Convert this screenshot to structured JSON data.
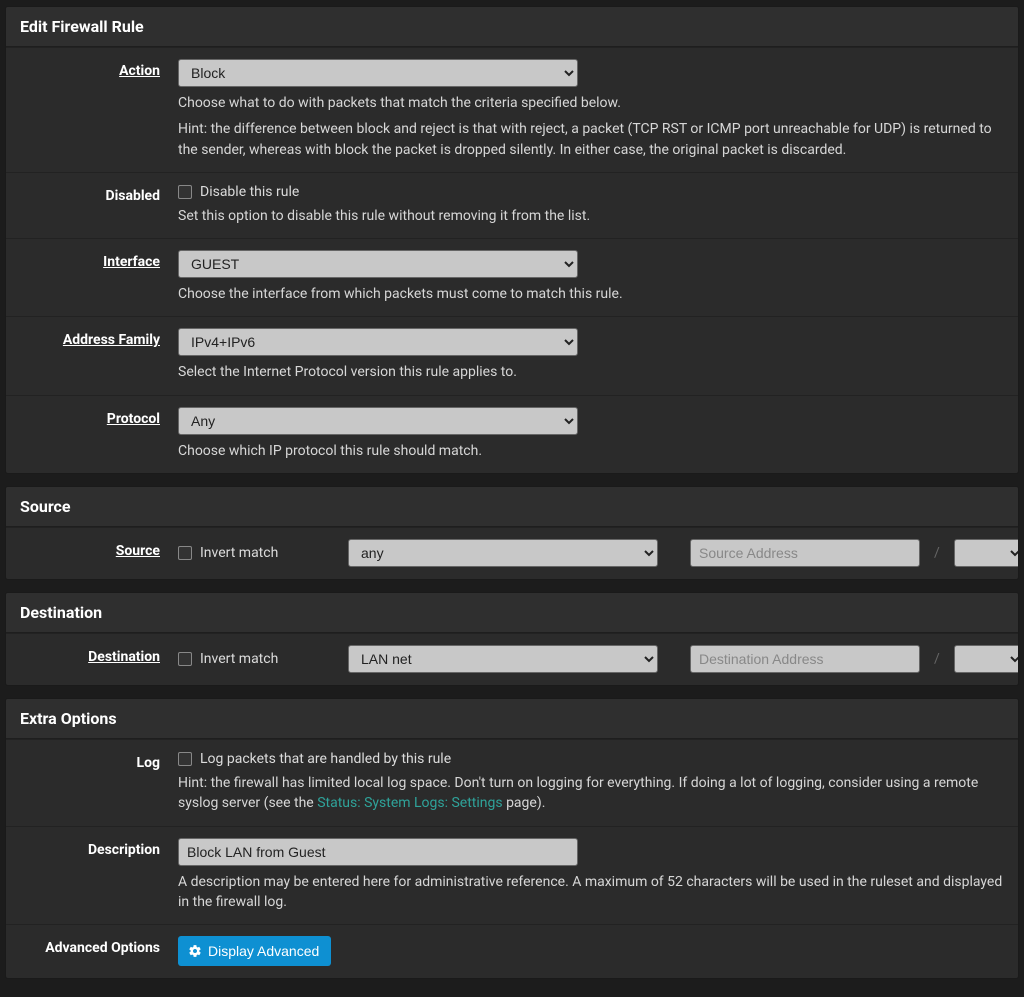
{
  "panel1": {
    "title": "Edit Firewall Rule",
    "action": {
      "label": "Action",
      "value": "Block",
      "hint1": "Choose what to do with packets that match the criteria specified below.",
      "hint2": "Hint: the difference between block and reject is that with reject, a packet (TCP RST or ICMP port unreachable for UDP) is returned to the sender, whereas with block the packet is dropped silently. In either case, the original packet is discarded."
    },
    "disabled": {
      "label": "Disabled",
      "cb": "Disable this rule",
      "hint": "Set this option to disable this rule without removing it from the list."
    },
    "interface": {
      "label": "Interface",
      "value": "GUEST",
      "hint": "Choose the interface from which packets must come to match this rule."
    },
    "afamily": {
      "label": "Address Family",
      "value": "IPv4+IPv6",
      "hint": "Select the Internet Protocol version this rule applies to."
    },
    "protocol": {
      "label": "Protocol",
      "value": "Any",
      "hint": "Choose which IP protocol this rule should match."
    }
  },
  "panel2": {
    "title": "Source",
    "label": "Source",
    "invert": "Invert match",
    "type": "any",
    "addr_ph": "Source Address",
    "mask": ""
  },
  "panel3": {
    "title": "Destination",
    "label": "Destination",
    "invert": "Invert match",
    "type": "LAN net",
    "addr_ph": "Destination Address",
    "mask": ""
  },
  "panel4": {
    "title": "Extra Options",
    "log": {
      "label": "Log",
      "cb": "Log packets that are handled by this rule",
      "hint_pre": "Hint: the firewall has limited local log space. Don't turn on logging for everything. If doing a lot of logging, consider using a remote syslog server (see the ",
      "hint_link": "Status: System Logs: Settings",
      "hint_post": " page)."
    },
    "desc": {
      "label": "Description",
      "value": "Block LAN from Guest",
      "hint": "A description may be entered here for administrative reference. A maximum of 52 characters will be used in the ruleset and displayed in the firewall log."
    },
    "adv": {
      "label": "Advanced Options",
      "btn": "Display Advanced"
    }
  }
}
